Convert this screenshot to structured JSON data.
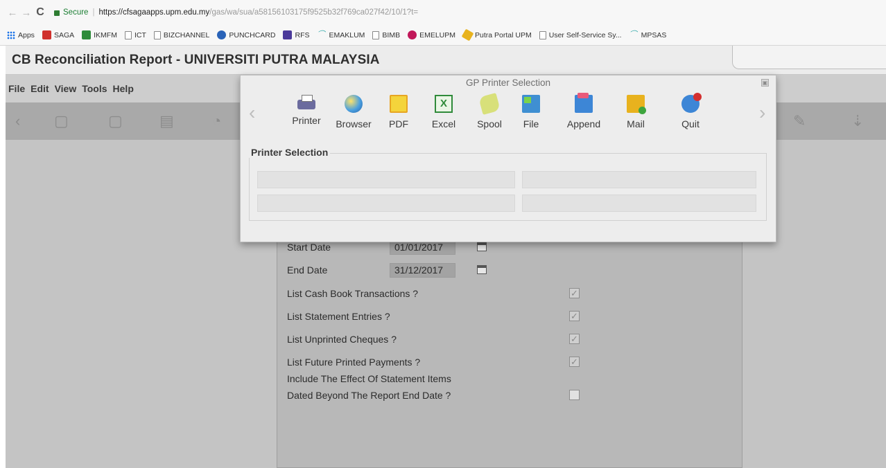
{
  "browser": {
    "back": "←",
    "forward": "→",
    "reload": "C",
    "secure_label": "Secure",
    "url_host": "https://cfsagaapps.upm.edu.my",
    "url_path": "/gas/wa/sua/a58156103175f9525b32f769ca027f42/10/1?t=",
    "bookmarks": [
      "Apps",
      "SAGA",
      "IKMFM",
      "ICT",
      "BIZCHANNEL",
      "PUNCHCARD",
      "RFS",
      "EMAKLUM",
      "BIMB",
      "EMELUPM",
      "Putra Portal UPM",
      "User Self-Service Sy...",
      "MPSAS"
    ]
  },
  "app": {
    "title": "CB Reconciliation Report - UNIVERSITI PUTRA MALAYSIA",
    "menu": [
      "File",
      "Edit",
      "View",
      "Tools",
      "Help"
    ]
  },
  "dialog": {
    "title": "GP Printer Selection",
    "close": "▣",
    "prev_arrow": "‹",
    "next_arrow": "›",
    "buttons": [
      "Printer",
      "Browser",
      "PDF",
      "Excel",
      "Spool",
      "File",
      "Append",
      "Mail",
      "Quit"
    ],
    "section_title": "Printer Selection"
  },
  "form": {
    "start_date_label": "Start Date",
    "start_date_value": "01/01/2017",
    "end_date_label": "End Date",
    "end_date_value": "31/12/2017",
    "options": [
      {
        "label": "List Cash Book Transactions ?",
        "checked": "✓"
      },
      {
        "label": "List Statement Entries ?",
        "checked": "✓"
      },
      {
        "label": "List Unprinted Cheques ?",
        "checked": "✓"
      },
      {
        "label": "List Future Printed Payments ?",
        "checked": "✓"
      },
      {
        "label": "Include The Effect Of Statement Items"
      },
      {
        "label": "Dated Beyond The Report End Date ?",
        "checked": ""
      }
    ]
  }
}
